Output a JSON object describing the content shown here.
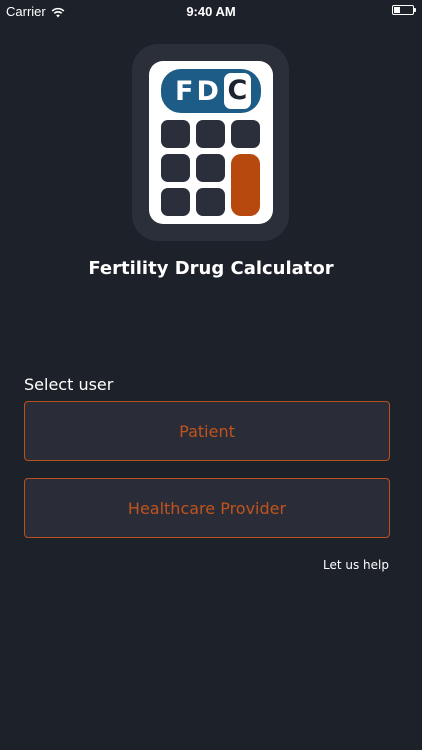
{
  "status_bar": {
    "carrier": "Carrier",
    "wifi_icon": "wifi-icon",
    "time": "9:40 AM",
    "battery_icon": "battery-icon",
    "battery_level": 0.35
  },
  "app_icon": {
    "display_letters": "FD",
    "display_last_letter": "C",
    "colors": {
      "display": "#1d5c86",
      "key": "#2a2f3b",
      "equals_key": "#b8490e"
    }
  },
  "app_title": "Fertility Drug Calculator",
  "select_user": {
    "label": "Select user",
    "options": [
      {
        "label": "Patient"
      },
      {
        "label": "Healthcare Provider"
      }
    ]
  },
  "help_link": "Let us help",
  "colors": {
    "background": "#1d212a",
    "accent": "#c0531c",
    "button_bg": "#2a2d38"
  }
}
